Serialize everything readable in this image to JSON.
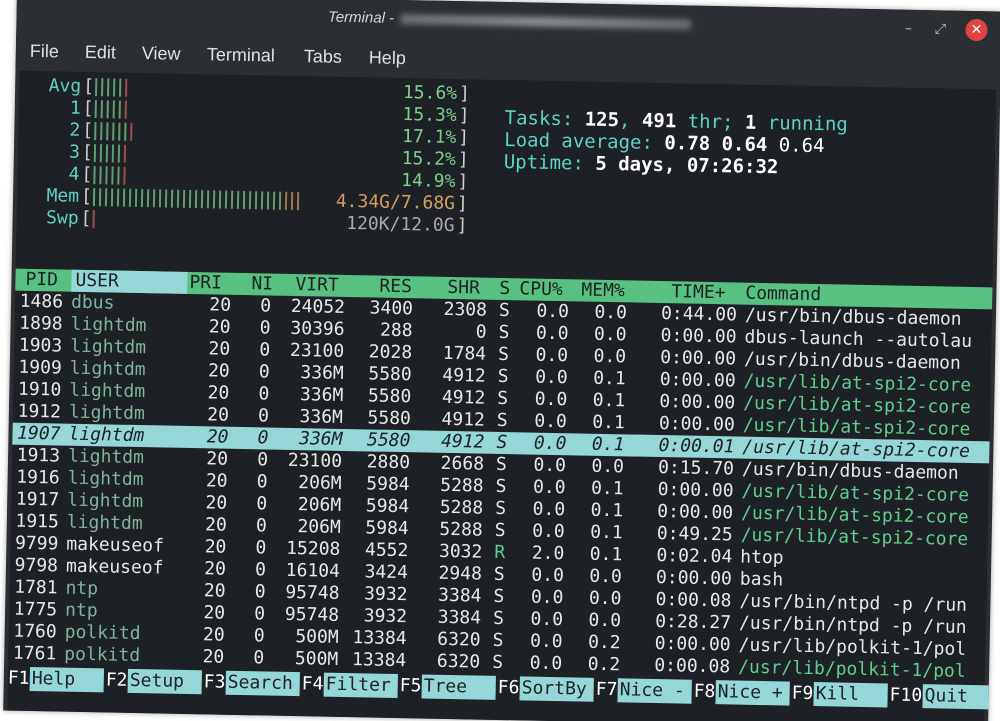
{
  "window": {
    "title": "Terminal -",
    "minimize_icon": "minimize-icon",
    "maximize_icon": "maximize-icon",
    "close_icon": "close-icon",
    "close_glyph": "✕",
    "minimize_glyph": "–",
    "maximize_glyph": "⤢"
  },
  "menu": [
    "File",
    "Edit",
    "View",
    "Terminal",
    "Tabs",
    "Help"
  ],
  "meters": [
    {
      "label": "Avg",
      "value": "15.6%"
    },
    {
      "label": "1",
      "value": "15.3%"
    },
    {
      "label": "2",
      "value": "17.1%"
    },
    {
      "label": "3",
      "value": "15.2%"
    },
    {
      "label": "4",
      "value": "14.9%"
    },
    {
      "label": "Mem",
      "value": "4.34G/7.68G"
    },
    {
      "label": "Swp",
      "value": "120K/12.0G"
    }
  ],
  "meter_fill": {
    "Avg": 0.156,
    "1": 0.153,
    "2": 0.171,
    "3": 0.152,
    "4": 0.149,
    "Mem": 0.565,
    "Swp": 0.01
  },
  "stats": {
    "tasks_label": "Tasks: ",
    "tasks": "125",
    "thr_sep": ", ",
    "thr": "491",
    "thr_label": " thr; ",
    "running": "1",
    "running_label": " running",
    "load_label": "Load average: ",
    "load1": "0.78",
    "load5": "0.64",
    "load15": "0.64",
    "uptime_label": "Uptime: ",
    "uptime": "5 days, 07:26:32"
  },
  "columns": [
    "PID",
    "USER",
    "PRI",
    "NI",
    "VIRT",
    "RES",
    "SHR",
    "S",
    "CPU%",
    "MEM%",
    "TIME+",
    "Command"
  ],
  "processes": [
    [
      "1486",
      "dbus",
      "20",
      "0",
      "24052",
      "3400",
      "2308",
      "S",
      "0.0",
      "0.0",
      "0:44.00",
      "/usr/bin/dbus-daemon"
    ],
    [
      "1898",
      "lightdm",
      "20",
      "0",
      "30396",
      "288",
      "0",
      "S",
      "0.0",
      "0.0",
      "0:00.00",
      "dbus-launch --autolau"
    ],
    [
      "1903",
      "lightdm",
      "20",
      "0",
      "23100",
      "2028",
      "1784",
      "S",
      "0.0",
      "0.0",
      "0:00.00",
      "/usr/bin/dbus-daemon"
    ],
    [
      "1909",
      "lightdm",
      "20",
      "0",
      "336M",
      "5580",
      "4912",
      "S",
      "0.0",
      "0.1",
      "0:00.00",
      "/usr/lib/at-spi2-core"
    ],
    [
      "1910",
      "lightdm",
      "20",
      "0",
      "336M",
      "5580",
      "4912",
      "S",
      "0.0",
      "0.1",
      "0:00.00",
      "/usr/lib/at-spi2-core"
    ],
    [
      "1912",
      "lightdm",
      "20",
      "0",
      "336M",
      "5580",
      "4912",
      "S",
      "0.0",
      "0.1",
      "0:00.00",
      "/usr/lib/at-spi2-core"
    ],
    [
      "1907",
      "lightdm",
      "20",
      "0",
      "336M",
      "5580",
      "4912",
      "S",
      "0.0",
      "0.1",
      "0:00.01",
      "/usr/lib/at-spi2-core"
    ],
    [
      "1913",
      "lightdm",
      "20",
      "0",
      "23100",
      "2880",
      "2668",
      "S",
      "0.0",
      "0.0",
      "0:15.70",
      "/usr/bin/dbus-daemon"
    ],
    [
      "1916",
      "lightdm",
      "20",
      "0",
      "206M",
      "5984",
      "5288",
      "S",
      "0.0",
      "0.1",
      "0:00.00",
      "/usr/lib/at-spi2-core"
    ],
    [
      "1917",
      "lightdm",
      "20",
      "0",
      "206M",
      "5984",
      "5288",
      "S",
      "0.0",
      "0.1",
      "0:00.00",
      "/usr/lib/at-spi2-core"
    ],
    [
      "1915",
      "lightdm",
      "20",
      "0",
      "206M",
      "5984",
      "5288",
      "S",
      "0.0",
      "0.1",
      "0:49.25",
      "/usr/lib/at-spi2-core"
    ],
    [
      "9799",
      "makeuseof",
      "20",
      "0",
      "15208",
      "4552",
      "3032",
      "R",
      "2.0",
      "0.1",
      "0:02.04",
      "htop"
    ],
    [
      "9798",
      "makeuseof",
      "20",
      "0",
      "16104",
      "3424",
      "2948",
      "S",
      "0.0",
      "0.0",
      "0:00.00",
      "bash"
    ],
    [
      "1781",
      "ntp",
      "20",
      "0",
      "95748",
      "3932",
      "3384",
      "S",
      "0.0",
      "0.0",
      "0:00.08",
      "/usr/bin/ntpd -p /run"
    ],
    [
      "1775",
      "ntp",
      "20",
      "0",
      "95748",
      "3932",
      "3384",
      "S",
      "0.0",
      "0.0",
      "0:28.27",
      "/usr/bin/ntpd -p /run"
    ],
    [
      "1760",
      "polkitd",
      "20",
      "0",
      "500M",
      "13384",
      "6320",
      "S",
      "0.0",
      "0.2",
      "0:00.00",
      "/usr/lib/polkit-1/pol"
    ],
    [
      "1761",
      "polkitd",
      "20",
      "0",
      "500M",
      "13384",
      "6320",
      "S",
      "0.0",
      "0.2",
      "0:00.08",
      "/usr/lib/polkit-1/pol"
    ]
  ],
  "selected_pid": "1907",
  "footer": [
    {
      "key": "F1",
      "label": "Help"
    },
    {
      "key": "F2",
      "label": "Setup"
    },
    {
      "key": "F3",
      "label": "Search"
    },
    {
      "key": "F4",
      "label": "Filter"
    },
    {
      "key": "F5",
      "label": "Tree"
    },
    {
      "key": "F6",
      "label": "SortBy"
    },
    {
      "key": "F7",
      "label": "Nice -"
    },
    {
      "key": "F8",
      "label": "Nice +"
    },
    {
      "key": "F9",
      "label": "Kill"
    },
    {
      "key": "F10",
      "label": "Quit"
    }
  ],
  "colors": {
    "terminal_bg": "#1d2024",
    "header_bg": "#58c080",
    "selection_bg": "#95d6d6",
    "meter_text": "#5fd3c3"
  }
}
